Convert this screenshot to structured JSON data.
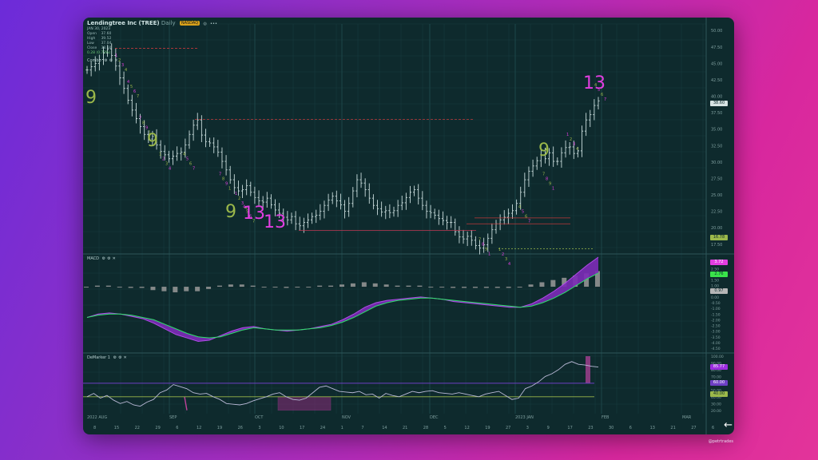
{
  "header": {
    "title": "Lendingtree Inc (TREE)",
    "interval": "Daily",
    "badge": "NASDAQ",
    "icons": [
      "settings-icon",
      "more-icon"
    ]
  },
  "ohlc": {
    "date": "JAN 30, 2023",
    "open_label": "Open",
    "open": "37.60",
    "high_label": "High",
    "high": "39.52",
    "low_label": "Low",
    "low": "37.04",
    "close_label": "Close",
    "close": "38.60",
    "change": "0.28 (0.73%)"
  },
  "panels": {
    "price": {
      "label": "Combo",
      "icons": [
        "settings-icon",
        "gear-icon",
        "close-icon"
      ]
    },
    "macd": {
      "label": "MACD",
      "icons": [
        "settings-icon",
        "gear-icon",
        "close-icon"
      ]
    },
    "demarker": {
      "label": "DeMarker 1",
      "icons": [
        "settings-icon",
        "gear-icon",
        "close-icon"
      ]
    }
  },
  "price_axis": [
    "50.00",
    "47.50",
    "45.00",
    "42.50",
    "40.00",
    "37.50",
    "35.00",
    "32.50",
    "30.00",
    "27.50",
    "25.00",
    "22.50",
    "20.00",
    "17.50"
  ],
  "price_badges": {
    "last": "38.60",
    "level": "16.78"
  },
  "macd_axis": [
    "3.00",
    "2.50",
    "2.00",
    "1.50",
    "1.00",
    "0.50",
    "0.00",
    "-0.50",
    "-1.00",
    "-1.50",
    "-2.00",
    "-2.50",
    "-3.00",
    "-3.50",
    "-4.00",
    "-4.50"
  ],
  "macd_badges": {
    "a": "3.72",
    "b": "2.76",
    "c": "0.97"
  },
  "dem_axis": [
    "100.00",
    "90.00",
    "80.00",
    "70.00",
    "60.00",
    "50.00",
    "40.00",
    "30.00",
    "20.00"
  ],
  "dem_badges": {
    "a": "85.77",
    "b": "60.00",
    "c": "40.00"
  },
  "month_labels": [
    "2022 AUG",
    "SEP",
    "OCT",
    "NOV",
    "DEC",
    "2023 JAN",
    "FEB",
    "MAR"
  ],
  "day_labels": [
    "8",
    "15",
    "22",
    "29",
    "6",
    "12",
    "19",
    "26",
    "3",
    "10",
    "17",
    "24",
    "1",
    "7",
    "14",
    "21",
    "28",
    "5",
    "12",
    "19",
    "27",
    "3",
    "9",
    "17",
    "23",
    "30",
    "6",
    "13",
    "21",
    "27",
    "6"
  ],
  "sequential_labels": {
    "s1": "9",
    "s2": "9",
    "s3": "9",
    "s4": "13",
    "s5": "13",
    "s6": "9",
    "s7": "13"
  },
  "credit": "@petrtrades",
  "colors": {
    "bull": "#b7cfcf",
    "green_seq": "#9bb84a",
    "magenta_seq": "#e23ee0",
    "macd_fill": "#7c2bb8",
    "dem_line": "#a98bd8"
  },
  "chart_data": [
    {
      "type": "line",
      "title": "Lendingtree Inc (TREE) Daily",
      "ylim": [
        16.5,
        51
      ],
      "series": [
        {
          "values": [
            44,
            44.5,
            45,
            45.6,
            46.6,
            47.2,
            46.2,
            44.6,
            42.8,
            41.2,
            39.4,
            37.9,
            36.6,
            35.4,
            34.2,
            33.5,
            33.9,
            32.6,
            31.6,
            31.1,
            30.5,
            30.9,
            31.3,
            31.5,
            32.6,
            34.2,
            35.6,
            36.4,
            34.1,
            33.1,
            32.9,
            32.3,
            31.5,
            30.1,
            28.8,
            27.3,
            26.1,
            25.6,
            25.8,
            26.4,
            25.4,
            24.6,
            24.1,
            23.9,
            24.5,
            23.5,
            22.7,
            22.2,
            21.6,
            21.2,
            21.7,
            20.6,
            20.3,
            20.8,
            21.2,
            21.7,
            21.9,
            22.5,
            23.4,
            24.2,
            24.8,
            24.1,
            23.5,
            22.5,
            23.7,
            25.6,
            27.3,
            26.8,
            25.8,
            24.5,
            23.4,
            22.9,
            22.4,
            22.6,
            22.3,
            22.6,
            23.4,
            23.8,
            24.6,
            25.4,
            25.8,
            24.5,
            23.4,
            22.5,
            22.3,
            21.9,
            21.4,
            21.1,
            20.8,
            20.8,
            19.4,
            18.6,
            18.3,
            18.7,
            18.1,
            17.3,
            16.9,
            17.4,
            18.4,
            19.7,
            20.6,
            21.2,
            21.6,
            22.2,
            22.6,
            23.7,
            25.4,
            27.3,
            28.6,
            29.4,
            30.2,
            31.1,
            30.5,
            31.4,
            30.1,
            30.1,
            31.4,
            32.2,
            32.3,
            31.3,
            31.7,
            34.7,
            36.4,
            37.2,
            38.6,
            39.3
          ]
        }
      ]
    },
    {
      "type": "line",
      "title": "MACD",
      "ylim": [
        -4.5,
        3.5
      ],
      "series": [
        {
          "values": [
            -1.8,
            -1.5,
            -1.4,
            -1.5,
            -1.7,
            -1.9,
            -2.3,
            -2.8,
            -3.3,
            -3.6,
            -3.9,
            -3.8,
            -3.4,
            -3.0,
            -2.7,
            -2.6,
            -2.8,
            -2.9,
            -3.0,
            -2.9,
            -2.8,
            -2.6,
            -2.4,
            -2.0,
            -1.5,
            -0.9,
            -0.5,
            -0.3,
            -0.2,
            -0.1,
            0.0,
            -0.1,
            -0.2,
            -0.4,
            -0.5,
            -0.6,
            -0.7,
            -0.8,
            -0.9,
            -0.9,
            -0.6,
            -0.1,
            0.5,
            1.2,
            2.0,
            2.8,
            3.5
          ]
        },
        {
          "values": [
            -1.8,
            -1.6,
            -1.5,
            -1.5,
            -1.6,
            -1.8,
            -2.0,
            -2.4,
            -2.8,
            -3.2,
            -3.5,
            -3.6,
            -3.5,
            -3.2,
            -2.9,
            -2.7,
            -2.8,
            -2.9,
            -2.9,
            -2.9,
            -2.8,
            -2.7,
            -2.5,
            -2.2,
            -1.8,
            -1.3,
            -0.8,
            -0.5,
            -0.3,
            -0.2,
            -0.1,
            -0.1,
            -0.2,
            -0.3,
            -0.4,
            -0.5,
            -0.6,
            -0.7,
            -0.8,
            -0.9,
            -0.8,
            -0.5,
            -0.1,
            0.4,
            1.0,
            1.6,
            2.1
          ]
        }
      ]
    },
    {
      "type": "line",
      "title": "DeMarker 1",
      "ylim": [
        15,
        100
      ],
      "series": [
        {
          "values": [
            40,
            45,
            38,
            42,
            35,
            30,
            33,
            28,
            26,
            32,
            36,
            46,
            50,
            58,
            55,
            52,
            46,
            44,
            45,
            40,
            36,
            30,
            29,
            28,
            30,
            34,
            37,
            40,
            44,
            46,
            40,
            36,
            35,
            38,
            46,
            54,
            56,
            52,
            48,
            47,
            46,
            48,
            43,
            44,
            38,
            45,
            42,
            40,
            44,
            48,
            46,
            48,
            49,
            46,
            45,
            44,
            46,
            44,
            42,
            40,
            44,
            46,
            48,
            42,
            36,
            38,
            52,
            56,
            62,
            70,
            74,
            80,
            88,
            92,
            88,
            87,
            85,
            84
          ]
        }
      ]
    }
  ]
}
